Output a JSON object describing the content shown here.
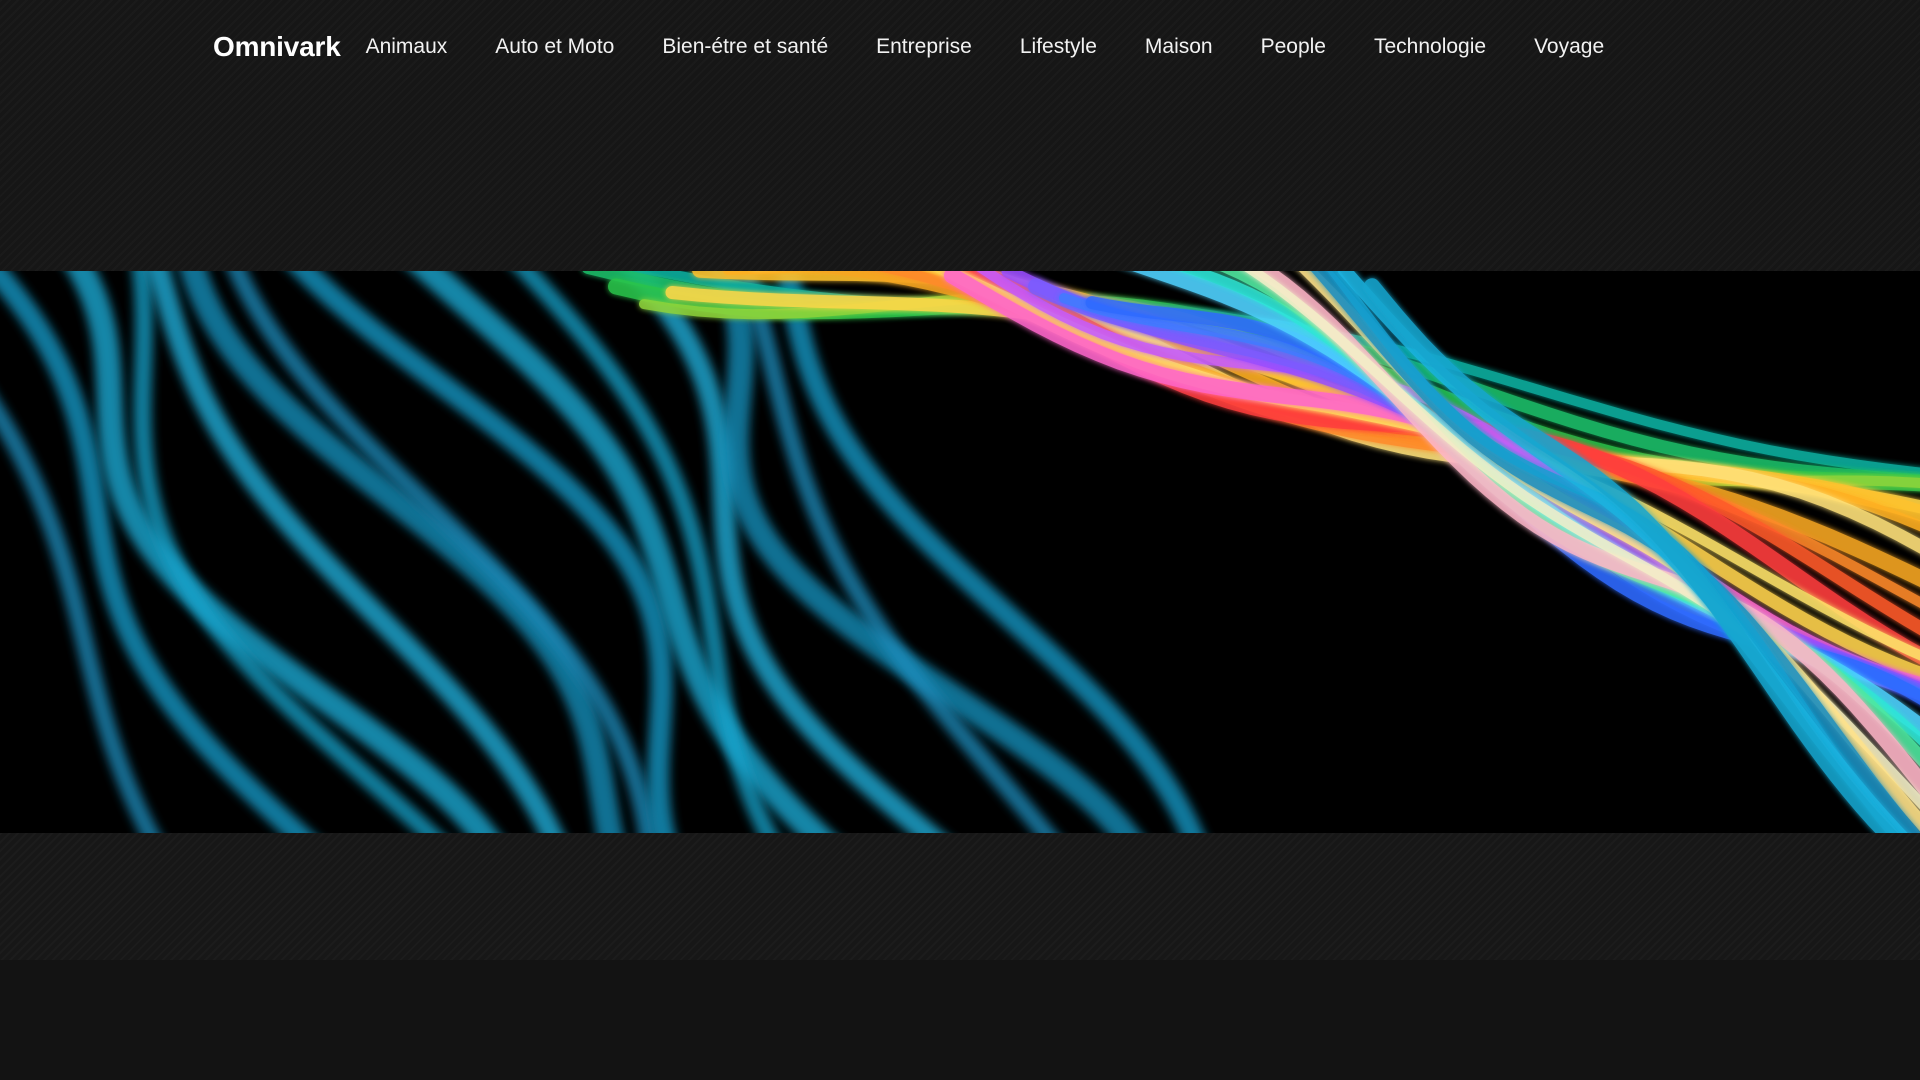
{
  "header": {
    "brand": "Omnivark",
    "nav": [
      {
        "label": "Animaux"
      },
      {
        "label": "Auto et Moto"
      },
      {
        "label": "Bien-étre et santé"
      },
      {
        "label": "Entreprise"
      },
      {
        "label": "Lifestyle"
      },
      {
        "label": "Maison"
      },
      {
        "label": "People"
      },
      {
        "label": "Technologie"
      },
      {
        "label": "Voyage"
      }
    ]
  },
  "hero": {
    "image": "abstract-rainbow-light-waves"
  },
  "colors": {
    "page_background": "#131313",
    "hero_background": "#000000",
    "nav_text": "#f2f2f2",
    "brand_text": "#ffffff"
  }
}
